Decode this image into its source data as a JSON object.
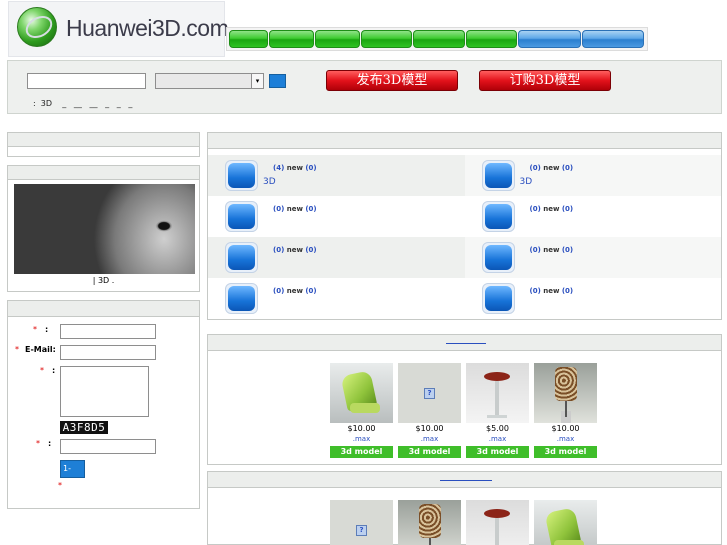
{
  "header": {
    "logo_text": "Huanwei3D.com",
    "nav_colors": {
      "active": "#2fc323",
      "inactive": "#4a9ae2"
    }
  },
  "search": {
    "input_value": "",
    "category_value": "",
    "publish_label": "发布3D模型",
    "order_label": "订购3D模型",
    "sublinks_text": ":  3D    _   __   __   _   _   _"
  },
  "left": {
    "banner_caption": "| 3D  .",
    "form": {
      "name_label": ":",
      "email_label": "E-Mail:",
      "message_label": ":",
      "captcha": "A3F8D5",
      "code_label": ":",
      "submit_label": "1-",
      "note": "*"
    }
  },
  "categories": {
    "rows": [
      [
        {
          "count": "(4)",
          "new_label": "new",
          "new": "(0)",
          "name": "3D",
          "icon": "robot-icon"
        },
        {
          "count": "(0)",
          "new_label": "new",
          "new": "(0)",
          "name": "3D",
          "icon": "speaker-icon"
        }
      ],
      [
        {
          "count": "(0)",
          "new_label": "new",
          "new": "(0)",
          "name": "",
          "icon": "dots-icon"
        },
        {
          "count": "(0)",
          "new_label": "new",
          "new": "(0)",
          "name": "",
          "icon": "clapperboard-icon"
        }
      ],
      [
        {
          "count": "(0)",
          "new_label": "new",
          "new": "(0)",
          "name": "",
          "icon": "book-icon"
        },
        {
          "count": "(0)",
          "new_label": "new",
          "new": "(0)",
          "name": "",
          "icon": "disc-icon"
        }
      ],
      [
        {
          "count": "(0)",
          "new_label": "new",
          "new": "(0)",
          "name": "",
          "icon": "figure-icon"
        },
        {
          "count": "(0)",
          "new_label": "new",
          "new": "(0)",
          "name": "",
          "icon": "car-icon"
        }
      ]
    ]
  },
  "models_top": [
    {
      "price": "$10.00",
      "ext": ".max",
      "tag": "3d model",
      "thumb": "chair"
    },
    {
      "price": "$10.00",
      "ext": ".max",
      "tag": "3d model",
      "thumb": "blank"
    },
    {
      "price": "$5.00",
      "ext": ".max",
      "tag": "3d model",
      "thumb": "stool"
    },
    {
      "price": "$10.00",
      "ext": ".max",
      "tag": "3d model",
      "thumb": "lamp"
    }
  ],
  "models_bottom": [
    {
      "thumb": "blank"
    },
    {
      "thumb": "lamp"
    },
    {
      "thumb": "stool"
    },
    {
      "thumb": "chair"
    }
  ]
}
